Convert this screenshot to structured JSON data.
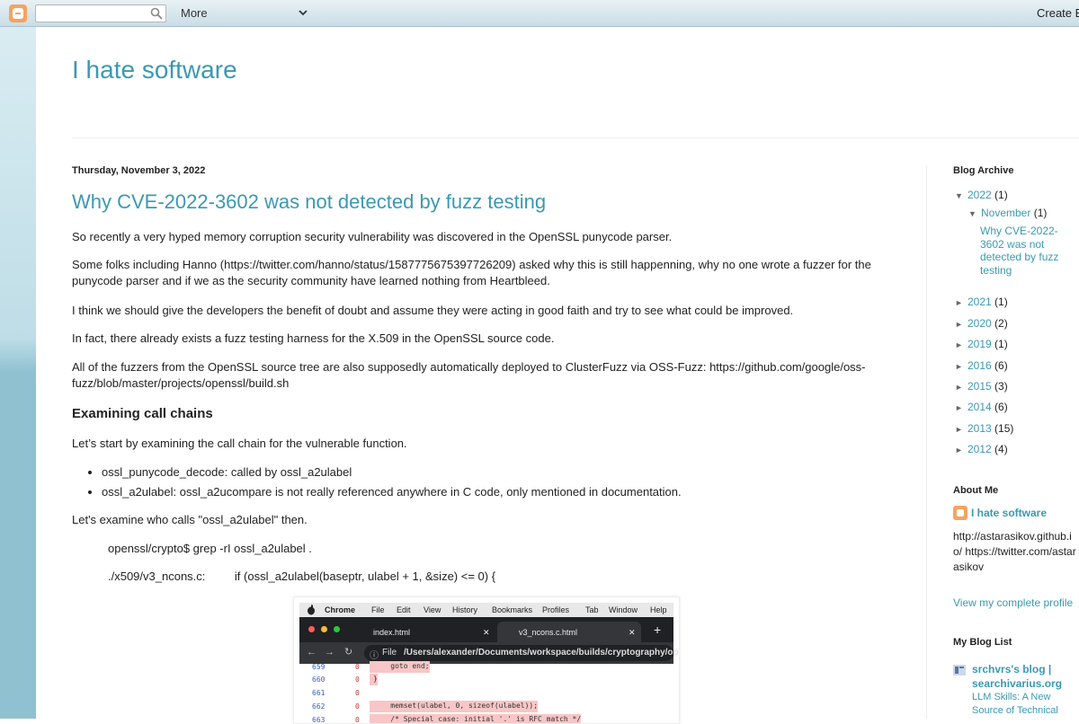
{
  "navbar": {
    "search_placeholder": "",
    "more_label": "More",
    "create_label": "Create B"
  },
  "blog": {
    "title": "I hate software"
  },
  "post": {
    "date": "Thursday, November 3, 2022",
    "title": "Why CVE-2022-3602 was not detected by fuzz testing",
    "paragraphs": [
      "So recently a very hyped memory corruption security vulnerability was discovered in the OpenSSL punycode parser.",
      "Some folks including Hanno (https://twitter.com/hanno/status/1587775675397726209) asked why this is still happenning, why no one wrote a fuzzer for the punycode parser and if we as the security community have learned nothing from Heartbleed.",
      "I think we should give the developers the benefit of doubt and assume they were acting in good faith and try to see what could be improved.",
      "In fact, there already exists a fuzz testing harness for the X.509 in the OpenSSL source code.",
      "All of the fuzzers from the OpenSSL source tree are also supposedly automatically deployed to ClusterFuzz via OSS-Fuzz: https://github.com/google/oss-fuzz/blob/master/projects/openssl/build.sh"
    ],
    "section_heading": "Examining call chains",
    "callchain_intro": "Let’s start by examining the call chain for the vulnerable function.",
    "callchain_items": [
      "ossl_punycode_decode: called by ossl_a2ulabel",
      "ossl_a2ulabel: ossl_a2ucompare is not really referenced anywhere in C code, only mentioned in documentation."
    ],
    "examine_text": "Let's examine who calls \"ossl_a2ulabel\" then.",
    "code_line1": "openssl/crypto$ grep -rI ossl_a2ulabel .",
    "code_line2": "./x509/v3_ncons.c:         if (ossl_a2ulabel(baseptr, ulabel + 1, &size) <= 0) {"
  },
  "screenshot": {
    "menubar": [
      "Chrome",
      "File",
      "Edit",
      "View",
      "History",
      "Bookmarks",
      "Profiles",
      "Tab",
      "Window",
      "Help"
    ],
    "tab1": "index.html",
    "tab2": "v3_ncons.c.html",
    "tab_close": "✕",
    "tab_new": "+",
    "addr_prefix": "File",
    "addr_path": "/Users/alexander/Documents/workspace/builds/cryptography/open",
    "code_rows": [
      {
        "num": "659",
        "zero": "0",
        "code": "    goto end;"
      },
      {
        "num": "660",
        "zero": "0",
        "code": "}"
      },
      {
        "num": "661",
        "zero": "0",
        "code": ""
      },
      {
        "num": "662",
        "zero": "0",
        "code": "    memset(ulabel, 0, sizeof(ulabel));"
      },
      {
        "num": "663",
        "zero": "0",
        "code": "    /* Special case: initial '.' is RFC match */"
      }
    ]
  },
  "sidebar": {
    "archive_heading": "Blog Archive",
    "archive": [
      {
        "triangle": "▼",
        "year": "2022",
        "count": "(1)"
      },
      {
        "triangle": "▼",
        "year": "November",
        "count": "(1)"
      },
      {
        "triangle": "►",
        "year": "2021",
        "count": "(1)"
      },
      {
        "triangle": "►",
        "year": "2020",
        "count": "(2)"
      },
      {
        "triangle": "►",
        "year": "2019",
        "count": "(1)"
      },
      {
        "triangle": "►",
        "year": "2016",
        "count": "(6)"
      },
      {
        "triangle": "►",
        "year": "2015",
        "count": "(3)"
      },
      {
        "triangle": "►",
        "year": "2014",
        "count": "(6)"
      },
      {
        "triangle": "►",
        "year": "2013",
        "count": "(15)"
      },
      {
        "triangle": "►",
        "year": "2012",
        "count": "(4)"
      }
    ],
    "archive_post": "Why CVE-2022-3602 was not detected by fuzz testing",
    "about_heading": "About Me",
    "about_name": "I hate software",
    "about_text": "http://astarasikov.github.io/ https://twitter.com/astarasikov",
    "about_profile": "View my complete profile",
    "bloglist_heading": "My Blog List",
    "bloglist_title": "srchvrs's blog | searchivarius.org",
    "bloglist_post": "LLM Skills: A New Source of Technical"
  },
  "colors": {
    "link": "#3a99b2",
    "accent_orange": "#f4a460"
  }
}
